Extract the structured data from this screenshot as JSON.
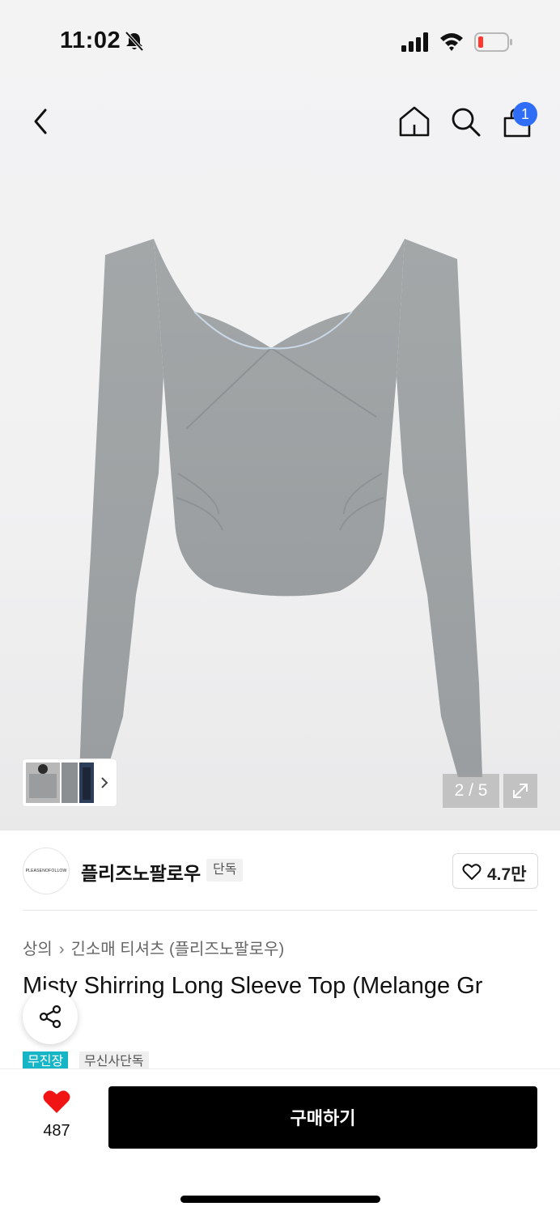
{
  "status_bar": {
    "time": "11:02",
    "icons": [
      "bell-off-icon",
      "signal-icon",
      "wifi-icon",
      "battery-low-icon"
    ],
    "battery_color": "#ff3b30"
  },
  "nav": {
    "icons": [
      "back-icon",
      "home-icon",
      "search-icon",
      "shopping-bag-icon"
    ],
    "cart_badge": "1",
    "cart_badge_color": "#2f6df6"
  },
  "gallery": {
    "page_counter": "2 / 5",
    "icons": [
      "chevron-right-icon",
      "expand-icon"
    ]
  },
  "brand": {
    "logo_text": "PLEASENOFOLLOW",
    "name": "플리즈노팔로우",
    "tag": "단독",
    "like_count": "4.7만",
    "like_icon": "heart-outline-icon"
  },
  "product": {
    "breadcrumb": [
      "상의",
      "긴소매 티셔츠 (플리즈노팔로우)"
    ],
    "title": "Misty Shirring Long Sleeve Top (Melange Gr",
    "tags": [
      {
        "label": "무진장",
        "color": "#17b6c6"
      },
      {
        "label": "무신사단독",
        "color": "#efefef"
      }
    ],
    "share_icon": "share-icon"
  },
  "bottom_bar": {
    "wish_count": "487",
    "wish_icon": "heart-filled-icon",
    "wish_color": "#f01414",
    "buy_label": "구매하기",
    "buy_color": "#000000"
  }
}
